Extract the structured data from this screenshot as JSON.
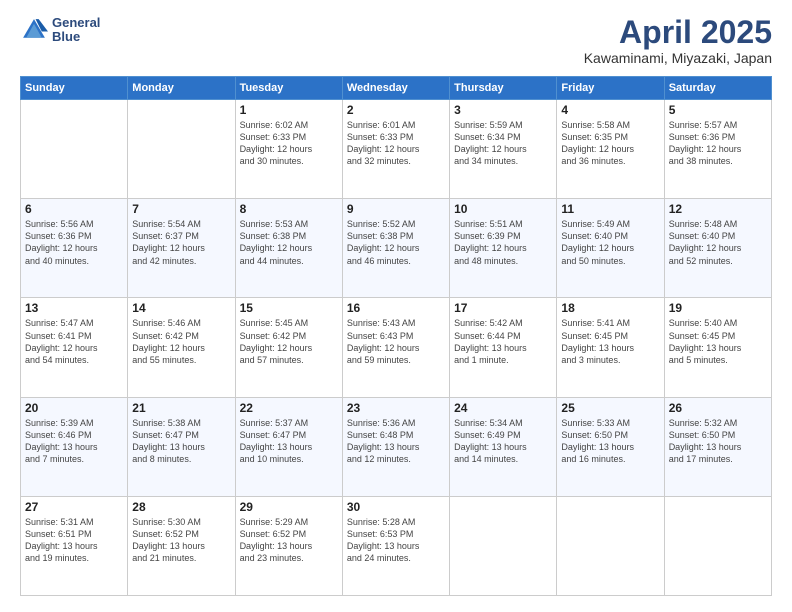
{
  "header": {
    "logo_line1": "General",
    "logo_line2": "Blue",
    "title": "April 2025",
    "location": "Kawaminami, Miyazaki, Japan"
  },
  "days_of_week": [
    "Sunday",
    "Monday",
    "Tuesday",
    "Wednesday",
    "Thursday",
    "Friday",
    "Saturday"
  ],
  "weeks": [
    [
      {
        "day": "",
        "info": ""
      },
      {
        "day": "",
        "info": ""
      },
      {
        "day": "1",
        "info": "Sunrise: 6:02 AM\nSunset: 6:33 PM\nDaylight: 12 hours\nand 30 minutes."
      },
      {
        "day": "2",
        "info": "Sunrise: 6:01 AM\nSunset: 6:33 PM\nDaylight: 12 hours\nand 32 minutes."
      },
      {
        "day": "3",
        "info": "Sunrise: 5:59 AM\nSunset: 6:34 PM\nDaylight: 12 hours\nand 34 minutes."
      },
      {
        "day": "4",
        "info": "Sunrise: 5:58 AM\nSunset: 6:35 PM\nDaylight: 12 hours\nand 36 minutes."
      },
      {
        "day": "5",
        "info": "Sunrise: 5:57 AM\nSunset: 6:36 PM\nDaylight: 12 hours\nand 38 minutes."
      }
    ],
    [
      {
        "day": "6",
        "info": "Sunrise: 5:56 AM\nSunset: 6:36 PM\nDaylight: 12 hours\nand 40 minutes."
      },
      {
        "day": "7",
        "info": "Sunrise: 5:54 AM\nSunset: 6:37 PM\nDaylight: 12 hours\nand 42 minutes."
      },
      {
        "day": "8",
        "info": "Sunrise: 5:53 AM\nSunset: 6:38 PM\nDaylight: 12 hours\nand 44 minutes."
      },
      {
        "day": "9",
        "info": "Sunrise: 5:52 AM\nSunset: 6:38 PM\nDaylight: 12 hours\nand 46 minutes."
      },
      {
        "day": "10",
        "info": "Sunrise: 5:51 AM\nSunset: 6:39 PM\nDaylight: 12 hours\nand 48 minutes."
      },
      {
        "day": "11",
        "info": "Sunrise: 5:49 AM\nSunset: 6:40 PM\nDaylight: 12 hours\nand 50 minutes."
      },
      {
        "day": "12",
        "info": "Sunrise: 5:48 AM\nSunset: 6:40 PM\nDaylight: 12 hours\nand 52 minutes."
      }
    ],
    [
      {
        "day": "13",
        "info": "Sunrise: 5:47 AM\nSunset: 6:41 PM\nDaylight: 12 hours\nand 54 minutes."
      },
      {
        "day": "14",
        "info": "Sunrise: 5:46 AM\nSunset: 6:42 PM\nDaylight: 12 hours\nand 55 minutes."
      },
      {
        "day": "15",
        "info": "Sunrise: 5:45 AM\nSunset: 6:42 PM\nDaylight: 12 hours\nand 57 minutes."
      },
      {
        "day": "16",
        "info": "Sunrise: 5:43 AM\nSunset: 6:43 PM\nDaylight: 12 hours\nand 59 minutes."
      },
      {
        "day": "17",
        "info": "Sunrise: 5:42 AM\nSunset: 6:44 PM\nDaylight: 13 hours\nand 1 minute."
      },
      {
        "day": "18",
        "info": "Sunrise: 5:41 AM\nSunset: 6:45 PM\nDaylight: 13 hours\nand 3 minutes."
      },
      {
        "day": "19",
        "info": "Sunrise: 5:40 AM\nSunset: 6:45 PM\nDaylight: 13 hours\nand 5 minutes."
      }
    ],
    [
      {
        "day": "20",
        "info": "Sunrise: 5:39 AM\nSunset: 6:46 PM\nDaylight: 13 hours\nand 7 minutes."
      },
      {
        "day": "21",
        "info": "Sunrise: 5:38 AM\nSunset: 6:47 PM\nDaylight: 13 hours\nand 8 minutes."
      },
      {
        "day": "22",
        "info": "Sunrise: 5:37 AM\nSunset: 6:47 PM\nDaylight: 13 hours\nand 10 minutes."
      },
      {
        "day": "23",
        "info": "Sunrise: 5:36 AM\nSunset: 6:48 PM\nDaylight: 13 hours\nand 12 minutes."
      },
      {
        "day": "24",
        "info": "Sunrise: 5:34 AM\nSunset: 6:49 PM\nDaylight: 13 hours\nand 14 minutes."
      },
      {
        "day": "25",
        "info": "Sunrise: 5:33 AM\nSunset: 6:50 PM\nDaylight: 13 hours\nand 16 minutes."
      },
      {
        "day": "26",
        "info": "Sunrise: 5:32 AM\nSunset: 6:50 PM\nDaylight: 13 hours\nand 17 minutes."
      }
    ],
    [
      {
        "day": "27",
        "info": "Sunrise: 5:31 AM\nSunset: 6:51 PM\nDaylight: 13 hours\nand 19 minutes."
      },
      {
        "day": "28",
        "info": "Sunrise: 5:30 AM\nSunset: 6:52 PM\nDaylight: 13 hours\nand 21 minutes."
      },
      {
        "day": "29",
        "info": "Sunrise: 5:29 AM\nSunset: 6:52 PM\nDaylight: 13 hours\nand 23 minutes."
      },
      {
        "day": "30",
        "info": "Sunrise: 5:28 AM\nSunset: 6:53 PM\nDaylight: 13 hours\nand 24 minutes."
      },
      {
        "day": "",
        "info": ""
      },
      {
        "day": "",
        "info": ""
      },
      {
        "day": "",
        "info": ""
      }
    ]
  ]
}
